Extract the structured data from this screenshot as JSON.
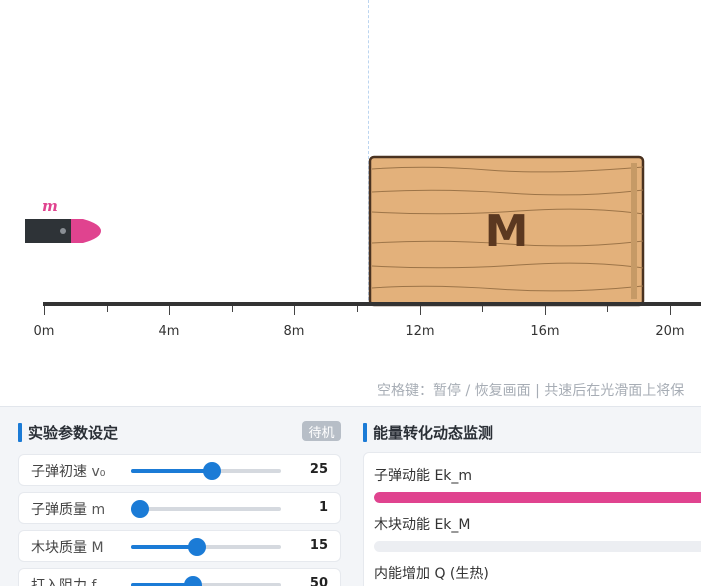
{
  "stage": {
    "ticks": [
      "0m",
      "4m",
      "8m",
      "12m",
      "16m",
      "20m"
    ],
    "bullet_label": "m",
    "block_label": "M",
    "hint": "空格键：暂停 / 恢复画面 | 共速后在光滑面上将保"
  },
  "params": {
    "title": "实验参数设定",
    "status": "待机",
    "rows": [
      {
        "label": "子弹初速",
        "symbol": "v₀",
        "value": "25",
        "level": 0.54
      },
      {
        "label": "子弹质量",
        "symbol": "m",
        "value": "1",
        "level": 0.06
      },
      {
        "label": "木块质量",
        "symbol": "M",
        "value": "15",
        "level": 0.44
      },
      {
        "label": "打入阻力",
        "symbol": "f",
        "value": "50",
        "level": 0.41
      }
    ]
  },
  "monitor": {
    "title": "能量转化动态监测",
    "items": [
      {
        "label": "子弹动能 Ek_m",
        "level": 1.0,
        "color": "#e0438f"
      },
      {
        "label": "木块动能 Ek_M",
        "level": 0.0,
        "color": "#1b7bd6"
      },
      {
        "label": "内能增加 Q (生热)",
        "level": 0.0,
        "color": "#f0a030"
      }
    ]
  }
}
